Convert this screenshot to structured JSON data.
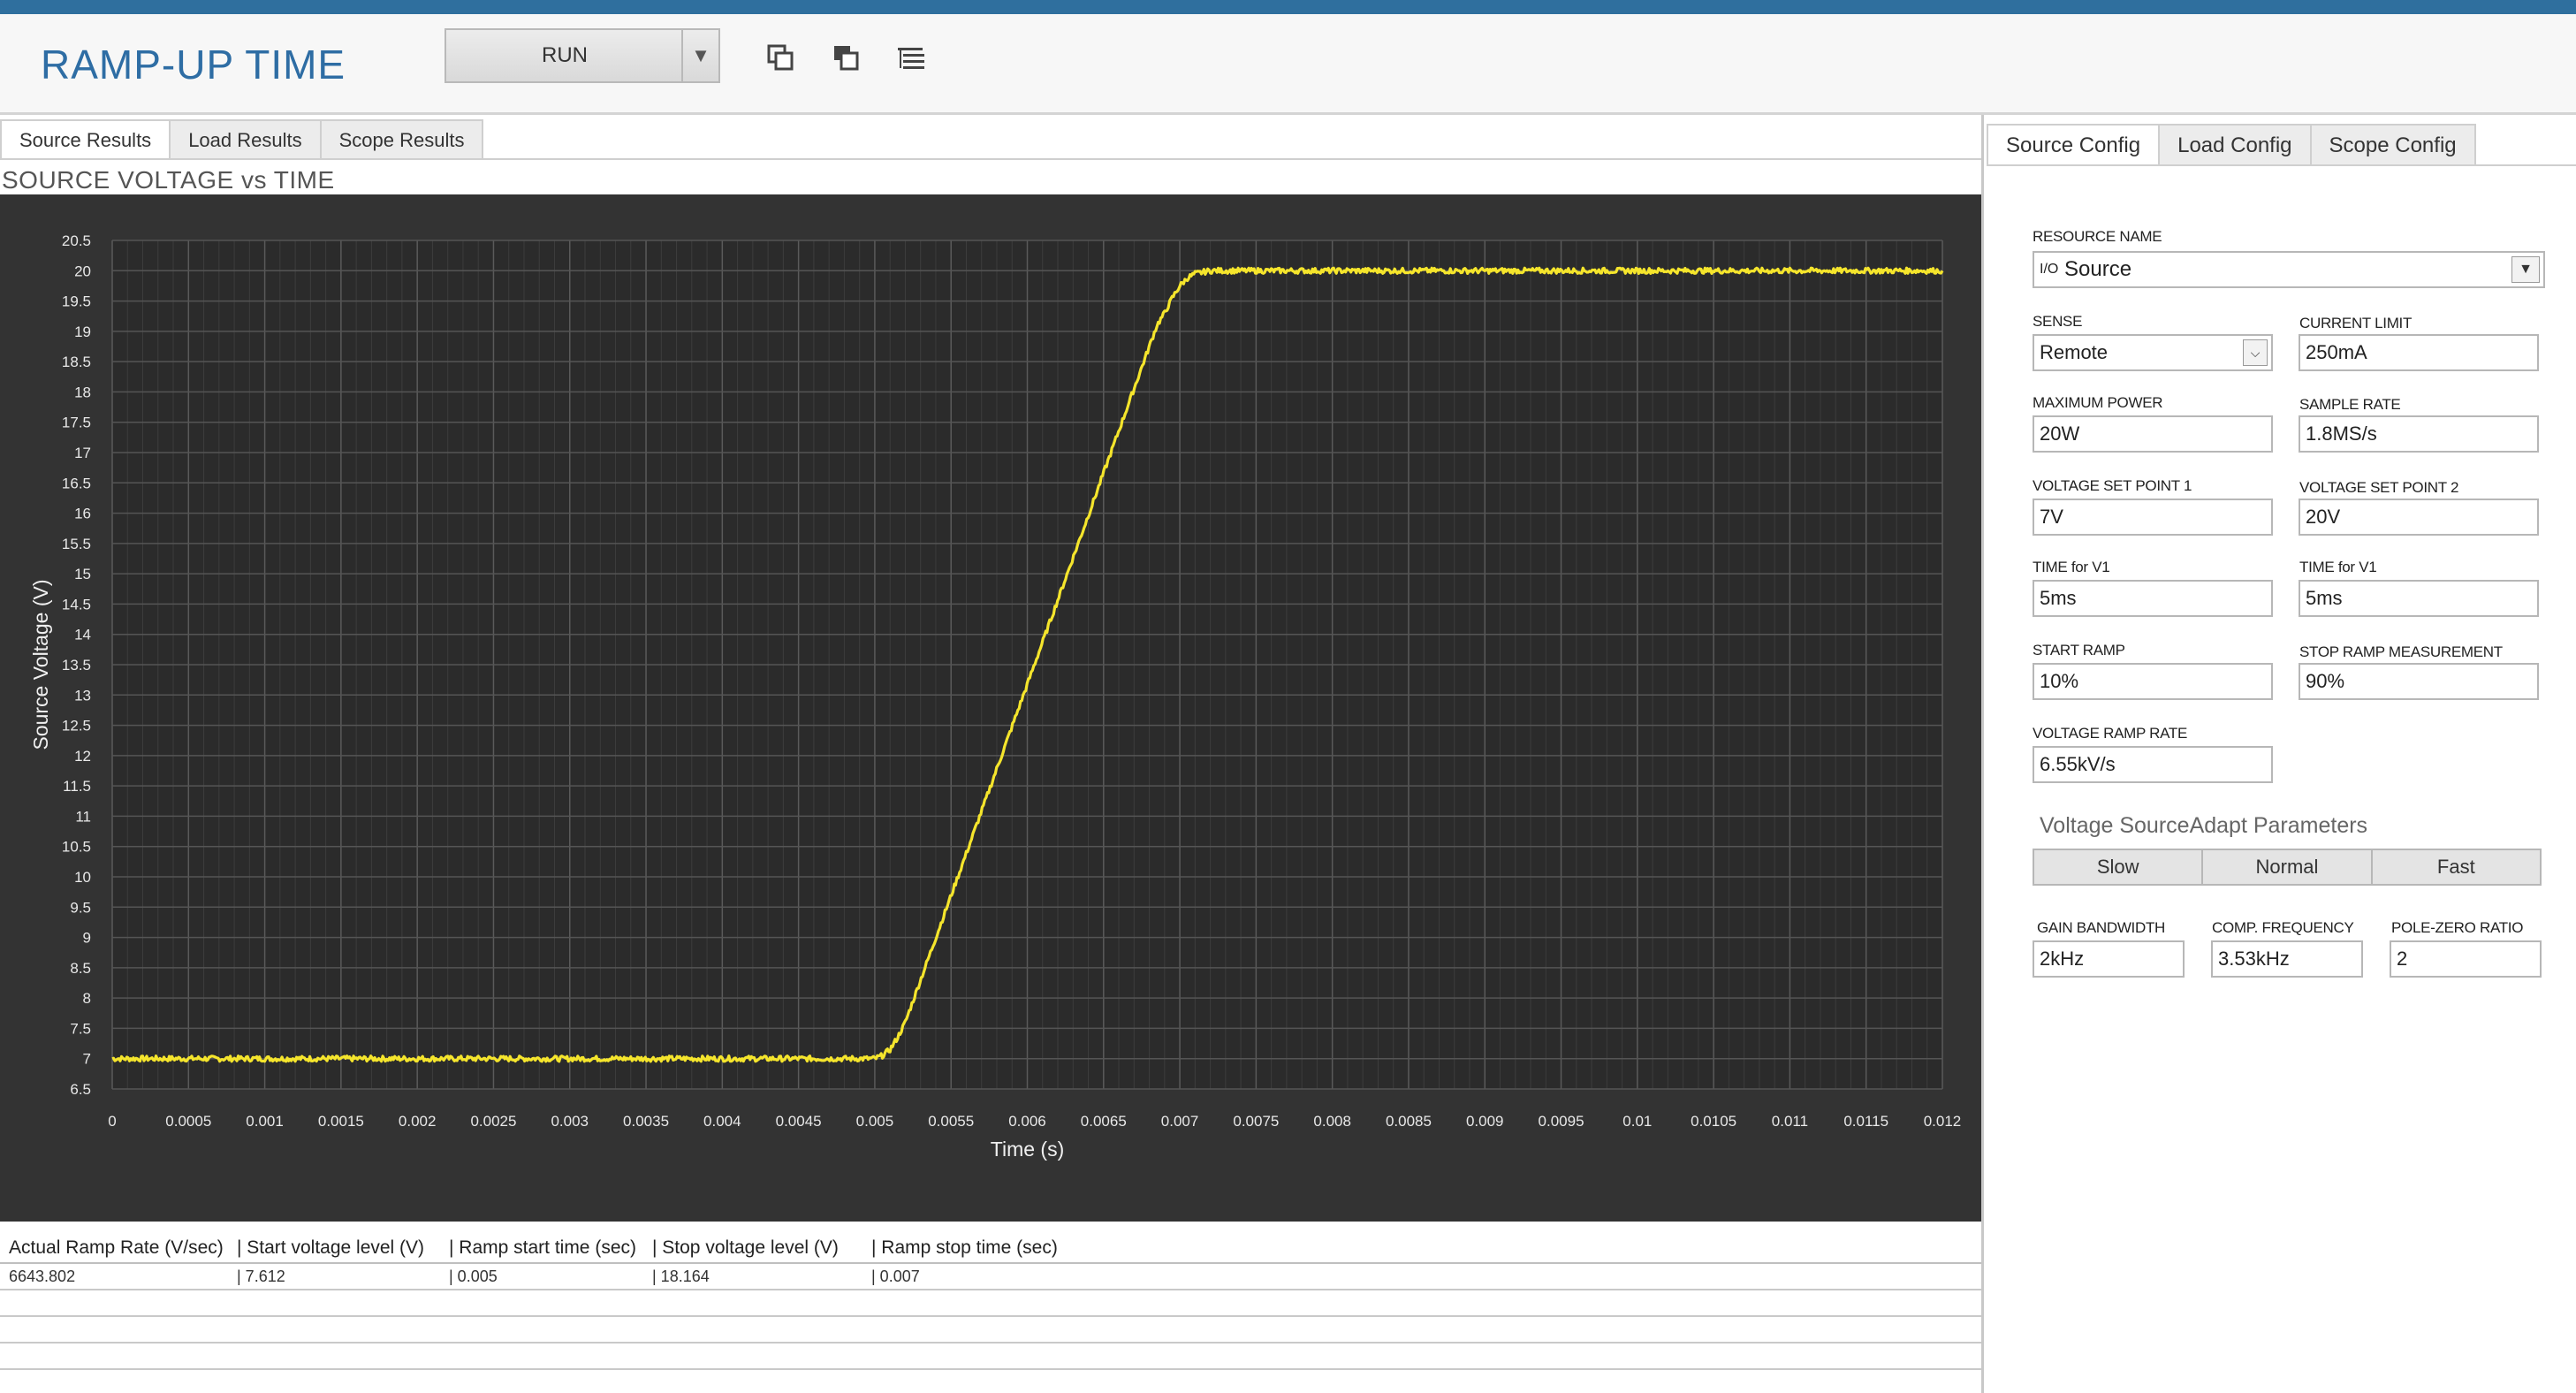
{
  "app": {
    "title": "RAMP-UP TIME"
  },
  "toolbar": {
    "run_select": "RUN",
    "icons": [
      "restore-window-icon",
      "cascade-window-icon",
      "tree-list-icon"
    ]
  },
  "left_tabs": [
    "Source Results",
    "Load Results",
    "Scope Results"
  ],
  "chart_title": "SOURCE VOLTAGE vs TIME",
  "chart_data": {
    "type": "line",
    "title": "SOURCE VOLTAGE vs TIME",
    "xlabel": "Time (s)",
    "ylabel": "Source  Voltage (V)",
    "xlim": [
      0,
      0.012
    ],
    "ylim": [
      6.5,
      20.5
    ],
    "x_ticks": [
      "0",
      "0.0005",
      "0.001",
      "0.0015",
      "0.002",
      "0.0025",
      "0.003",
      "0.0035",
      "0.004",
      "0.0045",
      "0.005",
      "0.0055",
      "0.006",
      "0.0065",
      "0.007",
      "0.0075",
      "0.008",
      "0.0085",
      "0.009",
      "0.0095",
      "0.01",
      "0.0105",
      "0.011",
      "0.0115",
      "0.012"
    ],
    "y_ticks": [
      "6.5",
      "7",
      "7.5",
      "8",
      "8.5",
      "9",
      "9.5",
      "10",
      "10.5",
      "11",
      "11.5",
      "12",
      "12.5",
      "13",
      "13.5",
      "14",
      "14.5",
      "15",
      "15.5",
      "16",
      "16.5",
      "17",
      "17.5",
      "18",
      "18.5",
      "19",
      "19.5",
      "20",
      "20.5"
    ],
    "grid": true,
    "series": [
      {
        "color": "#f5e52c",
        "x": [
          0,
          0.005,
          0.00505,
          0.0051,
          0.00515,
          0.0052,
          0.00685,
          0.0069,
          0.00695,
          0.007,
          0.00705,
          0.0071,
          0.0072,
          0.012
        ],
        "y": [
          7.0,
          7.0,
          7.05,
          7.15,
          7.35,
          7.6,
          19.1,
          19.3,
          19.55,
          19.75,
          19.88,
          19.95,
          20.0,
          20.0
        ]
      }
    ]
  },
  "results": {
    "headers": [
      "Actual Ramp Rate (V/sec)",
      "| Start voltage level (V)",
      "| Ramp start time (sec)",
      "| Stop voltage level (V)",
      "| Ramp  stop time (sec)"
    ],
    "rows": [
      [
        "6643.802",
        "| 7.612",
        "| 0.005",
        "| 18.164",
        "| 0.007"
      ]
    ]
  },
  "right_tabs": [
    "Source Config",
    "Load Config",
    "Scope Config"
  ],
  "config": {
    "resource_name": {
      "label": "RESOURCE NAME",
      "value": "Source",
      "icon": "io-icon"
    },
    "sense": {
      "label": "SENSE",
      "value": "Remote"
    },
    "current_limit": {
      "label": "CURRENT LIMIT",
      "value": "250mA"
    },
    "maximum_power": {
      "label": "MAXIMUM POWER",
      "value": "20W"
    },
    "sample_rate": {
      "label": "SAMPLE RATE",
      "value": "1.8MS/s"
    },
    "voltage_set_point_1": {
      "label": "VOLTAGE SET POINT 1",
      "value": "7V"
    },
    "voltage_set_point_2": {
      "label": "VOLTAGE SET POINT 2",
      "value": "20V"
    },
    "time_v1_a": {
      "label": "TIME for V1",
      "value": "5ms"
    },
    "time_v1_b": {
      "label": "TIME for V1",
      "value": "5ms"
    },
    "start_ramp": {
      "label": "START RAMP",
      "value": "10%"
    },
    "stop_ramp": {
      "label": "STOP RAMP MEASUREMENT",
      "value": "90%"
    },
    "voltage_ramp_rate": {
      "label": "VOLTAGE RAMP RATE",
      "value": "6.55kV/s"
    }
  },
  "source_adapt": {
    "title": "Voltage SourceAdapt Parameters",
    "buttons": [
      "Slow",
      "Normal",
      "Fast"
    ],
    "gain_bandwidth": {
      "label": "GAIN BANDWIDTH",
      "value": "2kHz"
    },
    "comp_frequency": {
      "label": "COMP. FREQUENCY",
      "value": "3.53kHz"
    },
    "pole_zero_ratio": {
      "label": "POLE-ZERO RATIO",
      "value": "2"
    }
  },
  "colors": {
    "accent": "#2f6f9e",
    "title_blue": "#2e6da4",
    "plot_bg": "#2b2b2b",
    "trace": "#f5e52c"
  }
}
